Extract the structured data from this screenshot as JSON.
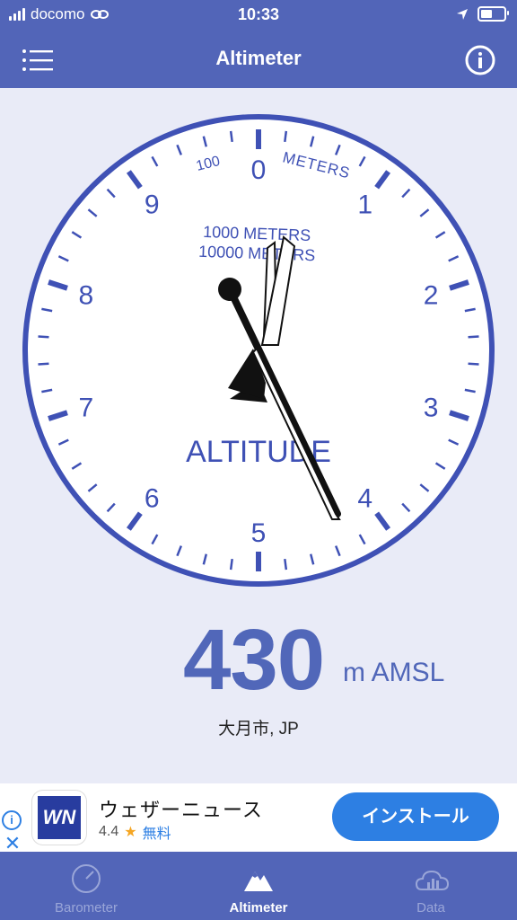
{
  "status_bar": {
    "carrier": "docomo",
    "time": "10:33"
  },
  "nav": {
    "title": "Altimeter",
    "menu_icon": "hamburger-menu-icon",
    "info_icon": "info-circle-icon"
  },
  "gauge": {
    "numbers": [
      "0",
      "1",
      "2",
      "3",
      "4",
      "5",
      "6",
      "7",
      "8",
      "9"
    ],
    "scale_label_meters": "METERS",
    "scale_label_100": "100",
    "inner_label_1000": "1000 METERS",
    "inner_label_10000": "10000 METERS",
    "dial_label": "ALTITUDE",
    "reading_m": 430
  },
  "reading": {
    "value": "430",
    "unit": "m AMSL"
  },
  "location": "大月市, JP",
  "ad": {
    "app_name": "ウェザーニュース",
    "rating": "4.4",
    "price": "無料",
    "install_label": "インストール",
    "logo_text": "WN"
  },
  "tabs": [
    {
      "label": "Barometer",
      "icon": "gauge-icon",
      "active": false
    },
    {
      "label": "Altimeter",
      "icon": "mountain-icon",
      "active": true
    },
    {
      "label": "Data",
      "icon": "cloud-chart-icon",
      "active": false
    }
  ],
  "colors": {
    "primary": "#5265b8",
    "dial": "#3f51b5",
    "background": "#e9ebf7",
    "accent": "#2d7fe3"
  }
}
